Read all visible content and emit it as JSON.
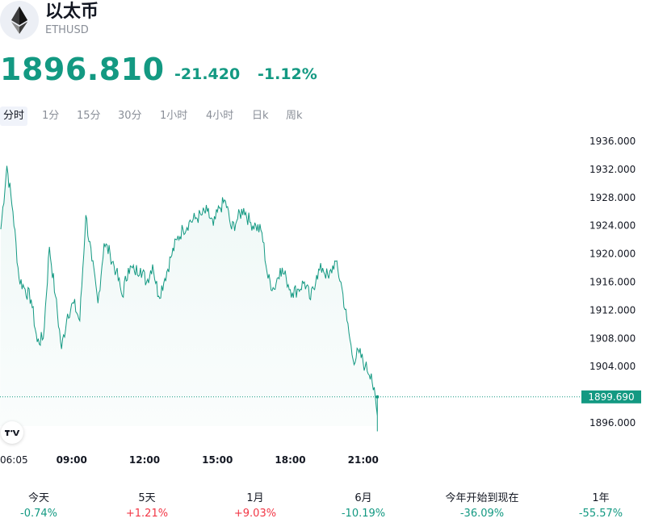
{
  "header": {
    "name": "以太币",
    "symbol": "ETHUSD",
    "logo_icon": "ethereum-icon"
  },
  "quote": {
    "price": "1896.810",
    "change": "-21.420",
    "change_pct": "-1.12%",
    "color": "#139982"
  },
  "tabs": [
    {
      "label": "分时",
      "active": true
    },
    {
      "label": "1分",
      "active": false
    },
    {
      "label": "15分",
      "active": false
    },
    {
      "label": "30分",
      "active": false
    },
    {
      "label": "1小时",
      "active": false
    },
    {
      "label": "4小时",
      "active": false
    },
    {
      "label": "日k",
      "active": false
    },
    {
      "label": "周k",
      "active": false
    }
  ],
  "chart_data": {
    "type": "area",
    "y_ticks": [
      "1936.000",
      "1932.000",
      "1928.000",
      "1924.000",
      "1920.000",
      "1916.000",
      "1912.000",
      "1908.000",
      "1904.000",
      "1896.000"
    ],
    "x_ticks": [
      "06:05",
      "09:00",
      "12:00",
      "15:00",
      "18:00",
      "21:00"
    ],
    "ylim": [
      1894.5,
      1937.8
    ],
    "last_value": 1899.69,
    "last_value_label": "1899.690",
    "line_color": "#139982",
    "x": [
      "06:05",
      "06:20",
      "06:35",
      "06:50",
      "07:05",
      "07:20",
      "07:35",
      "07:50",
      "08:05",
      "08:20",
      "08:35",
      "08:50",
      "09:05",
      "09:20",
      "09:35",
      "09:50",
      "10:05",
      "10:20",
      "10:35",
      "10:50",
      "11:05",
      "11:20",
      "11:35",
      "11:50",
      "12:05",
      "12:20",
      "12:35",
      "12:50",
      "13:05",
      "13:20",
      "13:35",
      "13:50",
      "14:05",
      "14:20",
      "14:35",
      "14:50",
      "15:05",
      "15:20",
      "15:35",
      "15:50",
      "16:05",
      "16:20",
      "16:35",
      "16:50",
      "17:05",
      "17:20",
      "17:35",
      "17:50",
      "18:05",
      "18:20",
      "18:35",
      "18:50",
      "19:05",
      "19:20",
      "19:35",
      "19:50",
      "20:05",
      "20:20",
      "20:35",
      "20:50",
      "21:05",
      "21:20",
      "21:35"
    ],
    "values": [
      1923.5,
      1932.5,
      1926.0,
      1916.5,
      1915.0,
      1913.5,
      1907.5,
      1908.0,
      1921.0,
      1914.0,
      1906.5,
      1911.5,
      1913.0,
      1910.5,
      1925.5,
      1919.0,
      1913.0,
      1921.5,
      1920.0,
      1917.5,
      1914.0,
      1918.0,
      1917.5,
      1918.0,
      1916.0,
      1918.5,
      1914.0,
      1916.5,
      1919.5,
      1922.0,
      1923.5,
      1924.5,
      1925.0,
      1925.5,
      1926.0,
      1924.0,
      1926.5,
      1927.5,
      1923.5,
      1925.0,
      1926.5,
      1924.5,
      1924.0,
      1923.0,
      1916.5,
      1915.0,
      1918.0,
      1916.5,
      1914.5,
      1915.0,
      1916.0,
      1913.5,
      1917.0,
      1918.0,
      1916.5,
      1919.0,
      1916.0,
      1910.5,
      1905.0,
      1906.0,
      1904.0,
      1903.0,
      1897.0
    ]
  },
  "performance": [
    {
      "label": "今天",
      "value": "-0.74%",
      "color": "#139982"
    },
    {
      "label": "5天",
      "value": "+1.21%",
      "color": "#f23645"
    },
    {
      "label": "1月",
      "value": "+9.03%",
      "color": "#f23645"
    },
    {
      "label": "6月",
      "value": "-10.19%",
      "color": "#139982"
    },
    {
      "label": "今年开始到现在",
      "value": "-36.09%",
      "color": "#139982"
    },
    {
      "label": "1年",
      "value": "-55.57%",
      "color": "#139982"
    }
  ]
}
